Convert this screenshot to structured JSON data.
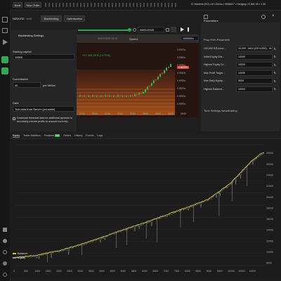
{
  "topbar": {
    "back_label": "Back",
    "new_order_label": "New Order",
    "account_info": "IC Markets (EU) Ltd • Demo • 9658617 • Hedging • € 861.55 • 1:30"
  },
  "tabs": {
    "symbol": "NZDUSD",
    "timeframe": "m10",
    "backtesting": "Backtesting",
    "optimisation": "Optimisation"
  },
  "backtest_settings": {
    "title": "Backtesting Settings",
    "starting_capital_label": "Starting capital",
    "starting_capital_value": "10000",
    "commission_label": "Commission",
    "commission_value": "40",
    "commission_unit": "per Million",
    "data_label": "Data",
    "data_value": "Tick data from Server (accurate)",
    "download_note": "Download historical data for additional symbols to accurately convert profits to account currency"
  },
  "chart_controls": {
    "end_date": "06/01/2025",
    "speed_label": "Speed:",
    "speed_value": "1000000x"
  },
  "mini_chart": {
    "pnl_badge": "+17,181.20 € (+171%)",
    "date_badge": "06/01/2025 15:10",
    "current_price": "0.60009",
    "price_ticks": [
      "0.5970s",
      "0.5960s",
      "0.5950s",
      "0.5940s",
      "0.5930s",
      "0.5920s",
      "0.5910s",
      "0.5900s"
    ],
    "time_ticks": [
      "07:10",
      "07:20",
      "07:30",
      "07:40",
      "07:50",
      "08:00",
      "08:10",
      "08:20",
      "08:50"
    ]
  },
  "parameters": {
    "title": "Parameters",
    "section": "Prop Firm Parameter",
    "rows": [
      {
        "label": "100,000 K/$ Acco...",
        "value": "10,000 - MAX (DD 5,000) - ID..."
      },
      {
        "label": "Initial Equity Dra...",
        "value": "10000"
      },
      {
        "label": "Highest Equity Dr...",
        "value": "10000"
      },
      {
        "label": "Max Profit Target...",
        "value": "10000"
      },
      {
        "label": "Max Daily Equity...",
        "value": "5000"
      },
      {
        "label": "Highest Balance...",
        "value": "10000"
      }
    ],
    "footer": "Time Settings Newstrading"
  },
  "bottom_tabs": [
    "Equity",
    "Trade Statistics",
    "Positions",
    "Orders",
    "History",
    "Events",
    "Logs"
  ],
  "bottom_tab_badges": {
    "Positions": "500"
  },
  "sidebar_icons": [
    "file-icon",
    "folder-icon",
    "play-icon",
    "chart-icon",
    "search-icon"
  ],
  "sidebar_bottom_icons": [
    "lock-icon",
    "info-icon",
    "settings-icon",
    "user-icon",
    "help-icon"
  ],
  "chart_data": {
    "type": "line",
    "series": [
      {
        "name": "Balance"
      },
      {
        "name": "Equity"
      }
    ],
    "x": [
      0,
      1000,
      2000,
      3000,
      4000,
      5000,
      6000,
      7000,
      8000,
      9000,
      10000,
      11000,
      11500
    ],
    "balance": [
      9000,
      9400,
      10200,
      11300,
      12600,
      14000,
      15300,
      16700,
      18100,
      19600,
      22400,
      26500,
      28000
    ],
    "equity_dips": [
      [
        1500,
        8100
      ],
      [
        3100,
        9400
      ],
      [
        4700,
        10700
      ],
      [
        5200,
        11200
      ],
      [
        6100,
        12400
      ],
      [
        6600,
        11800
      ],
      [
        7700,
        14400
      ],
      [
        8300,
        15400
      ],
      [
        9500,
        16500
      ],
      [
        10100,
        19200
      ],
      [
        10800,
        22000
      ]
    ],
    "xticks": [
      "0",
      "500",
      "1000",
      "1500",
      "2000",
      "2500",
      "3000",
      "3500",
      "4000",
      "4500",
      "5000",
      "5500",
      "6000",
      "6500",
      "7000",
      "7500",
      "8000",
      "8500",
      "9000",
      "9500",
      "10000",
      "10500",
      "11000"
    ],
    "yticks": [
      "28000",
      "26000",
      "24000",
      "22000",
      "20000",
      "18000",
      "16000",
      "14000",
      "12000",
      "10000",
      "8000"
    ],
    "ylim": [
      7500,
      29500
    ],
    "xlim": [
      0,
      11600
    ],
    "legend_position": "bottom-left",
    "colors": {
      "balance": "#c9cc3a",
      "equity": "#9a9a9a"
    }
  }
}
